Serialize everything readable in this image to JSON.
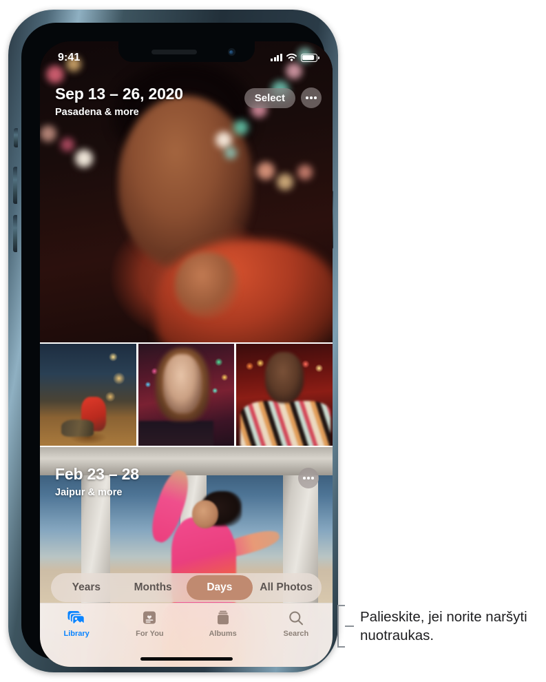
{
  "status_bar": {
    "time": "9:41",
    "signal_icon": "cellular-signal-icon",
    "wifi_icon": "wifi-icon",
    "battery_icon": "battery-icon"
  },
  "sections": [
    {
      "title": "Sep 13 – 26, 2020",
      "subtitle": "Pasadena & more",
      "select_label": "Select",
      "more_icon": "ellipsis-icon"
    },
    {
      "title": "Feb 23 – 28",
      "subtitle": "Jaipur & more",
      "more_icon": "ellipsis-icon"
    }
  ],
  "segmented_control": {
    "items": [
      {
        "label": "Years",
        "selected": false
      },
      {
        "label": "Months",
        "selected": false
      },
      {
        "label": "Days",
        "selected": true
      },
      {
        "label": "All Photos",
        "selected": false
      }
    ],
    "selected_bg": "#c08a70"
  },
  "tab_bar": {
    "tabs": [
      {
        "label": "Library",
        "icon": "photo-stack-icon",
        "active": true
      },
      {
        "label": "For You",
        "icon": "heart-card-icon",
        "active": false
      },
      {
        "label": "Albums",
        "icon": "albums-stack-icon",
        "active": false
      },
      {
        "label": "Search",
        "icon": "search-icon",
        "active": false
      }
    ],
    "active_color": "#0a84ff",
    "inactive_color": "#8d8178"
  },
  "callout": {
    "text": "Palieskite, jei norite naršyti nuotraukas."
  }
}
